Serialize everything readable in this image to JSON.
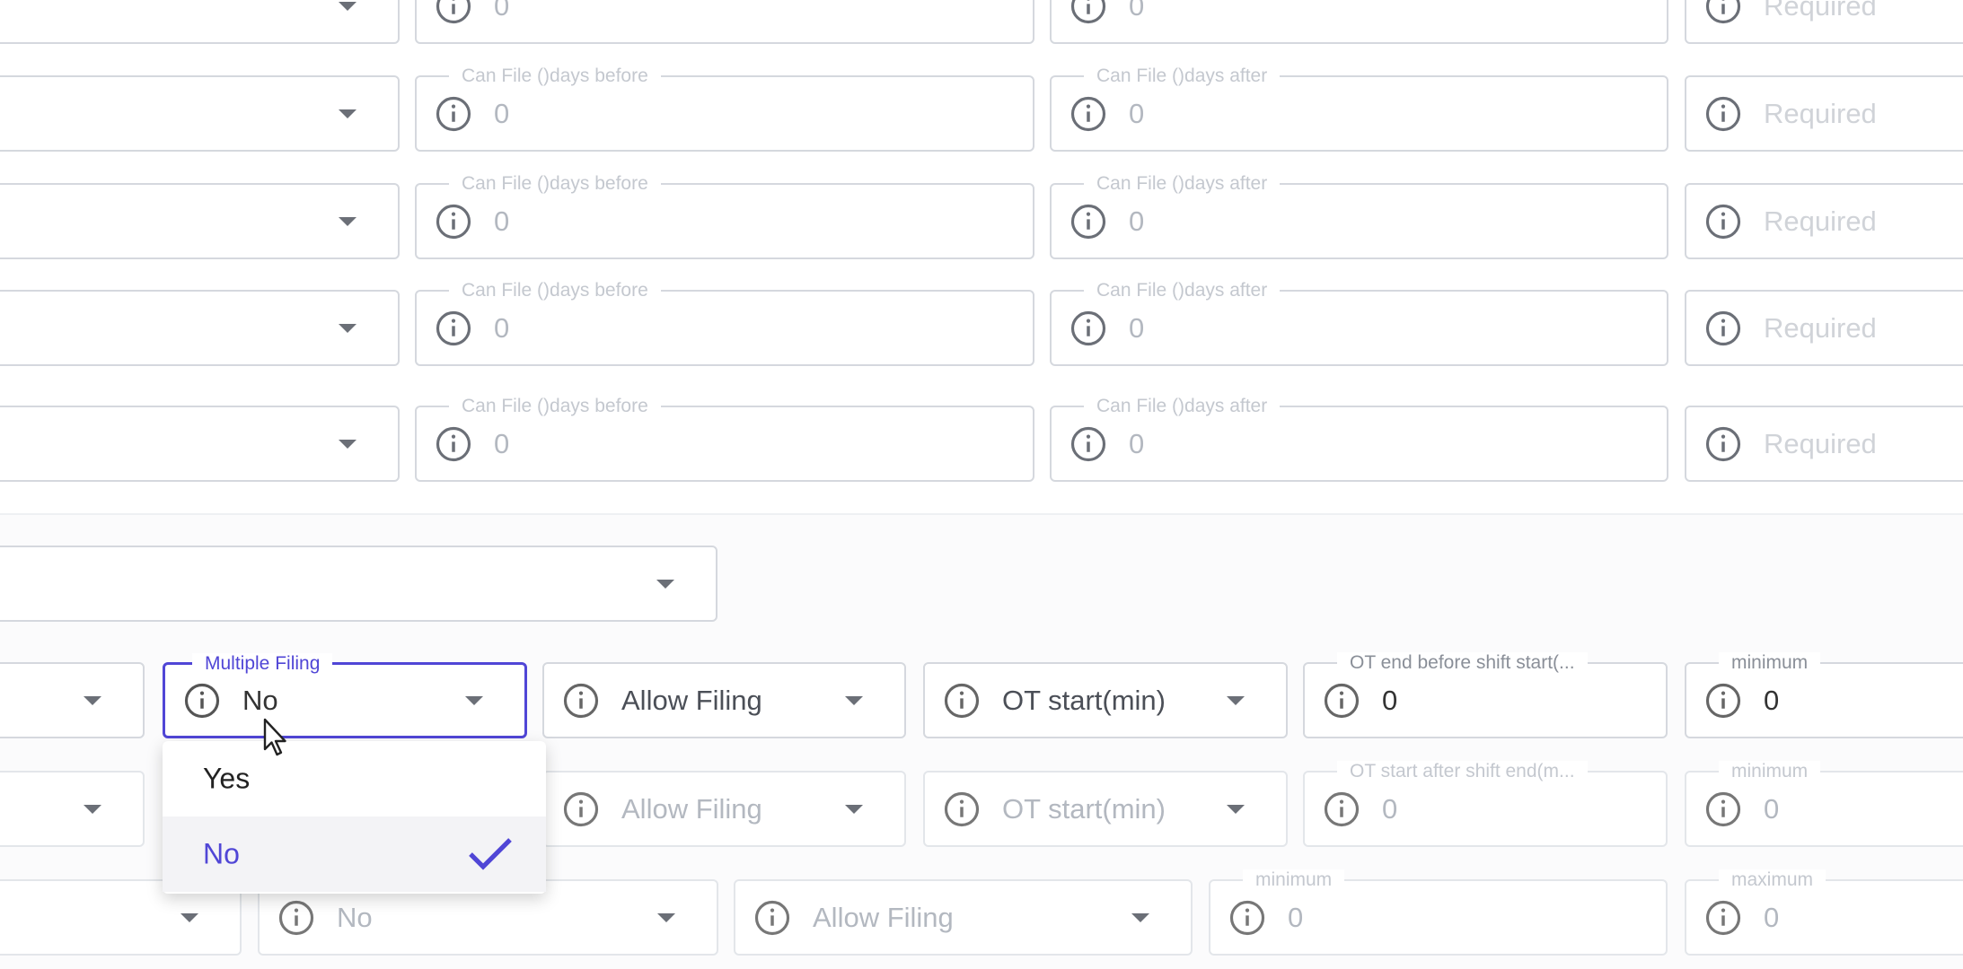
{
  "placeholder_required": "Required",
  "rows": [
    {
      "before_label": "",
      "before_value": "0",
      "after_label": "",
      "after_value": "0"
    },
    {
      "before_label": "Can File ()days before",
      "before_value": "0",
      "after_label": "Can File ()days after",
      "after_value": "0"
    },
    {
      "before_label": "Can File ()days before",
      "before_value": "0",
      "after_label": "Can File ()days after",
      "after_value": "0"
    },
    {
      "before_label": "Can File ()days before",
      "before_value": "0",
      "after_label": "Can File ()days after",
      "after_value": "0"
    },
    {
      "before_label": "Can File ()days before",
      "before_value": "0",
      "after_label": "Can File ()days after",
      "after_value": "0"
    }
  ],
  "ot1": {
    "multiple_filing_label": "Multiple Filing",
    "multiple_filing_value": "No",
    "allow_filing": "Allow Filing",
    "ot_start": "OT start(min)",
    "ot_end_label": "OT end before shift start(...",
    "ot_end_value": "0",
    "minimum_label": "minimum",
    "minimum_value": "0"
  },
  "ot2": {
    "allow_filing": "Allow Filing",
    "ot_start": "OT start(min)",
    "ot_after_label": "OT start after shift end(m...",
    "ot_after_value": "0",
    "minimum_label": "minimum",
    "minimum_value": "0"
  },
  "row3": {
    "no_value": "No",
    "allow_filing": "Allow Filing",
    "minimum_label": "minimum",
    "minimum_value": "0",
    "maximum_label": "maximum",
    "maximum_value": "0"
  },
  "dropdown": {
    "options": [
      {
        "label": "Yes",
        "selected": false
      },
      {
        "label": "No",
        "selected": true
      }
    ]
  },
  "colors": {
    "accent": "#5046d6",
    "border": "#d5d8de",
    "placeholder": "#b3b8c0"
  },
  "icons": [
    "info-icon",
    "chevron-down-icon",
    "check-icon",
    "mouse-cursor-icon"
  ]
}
